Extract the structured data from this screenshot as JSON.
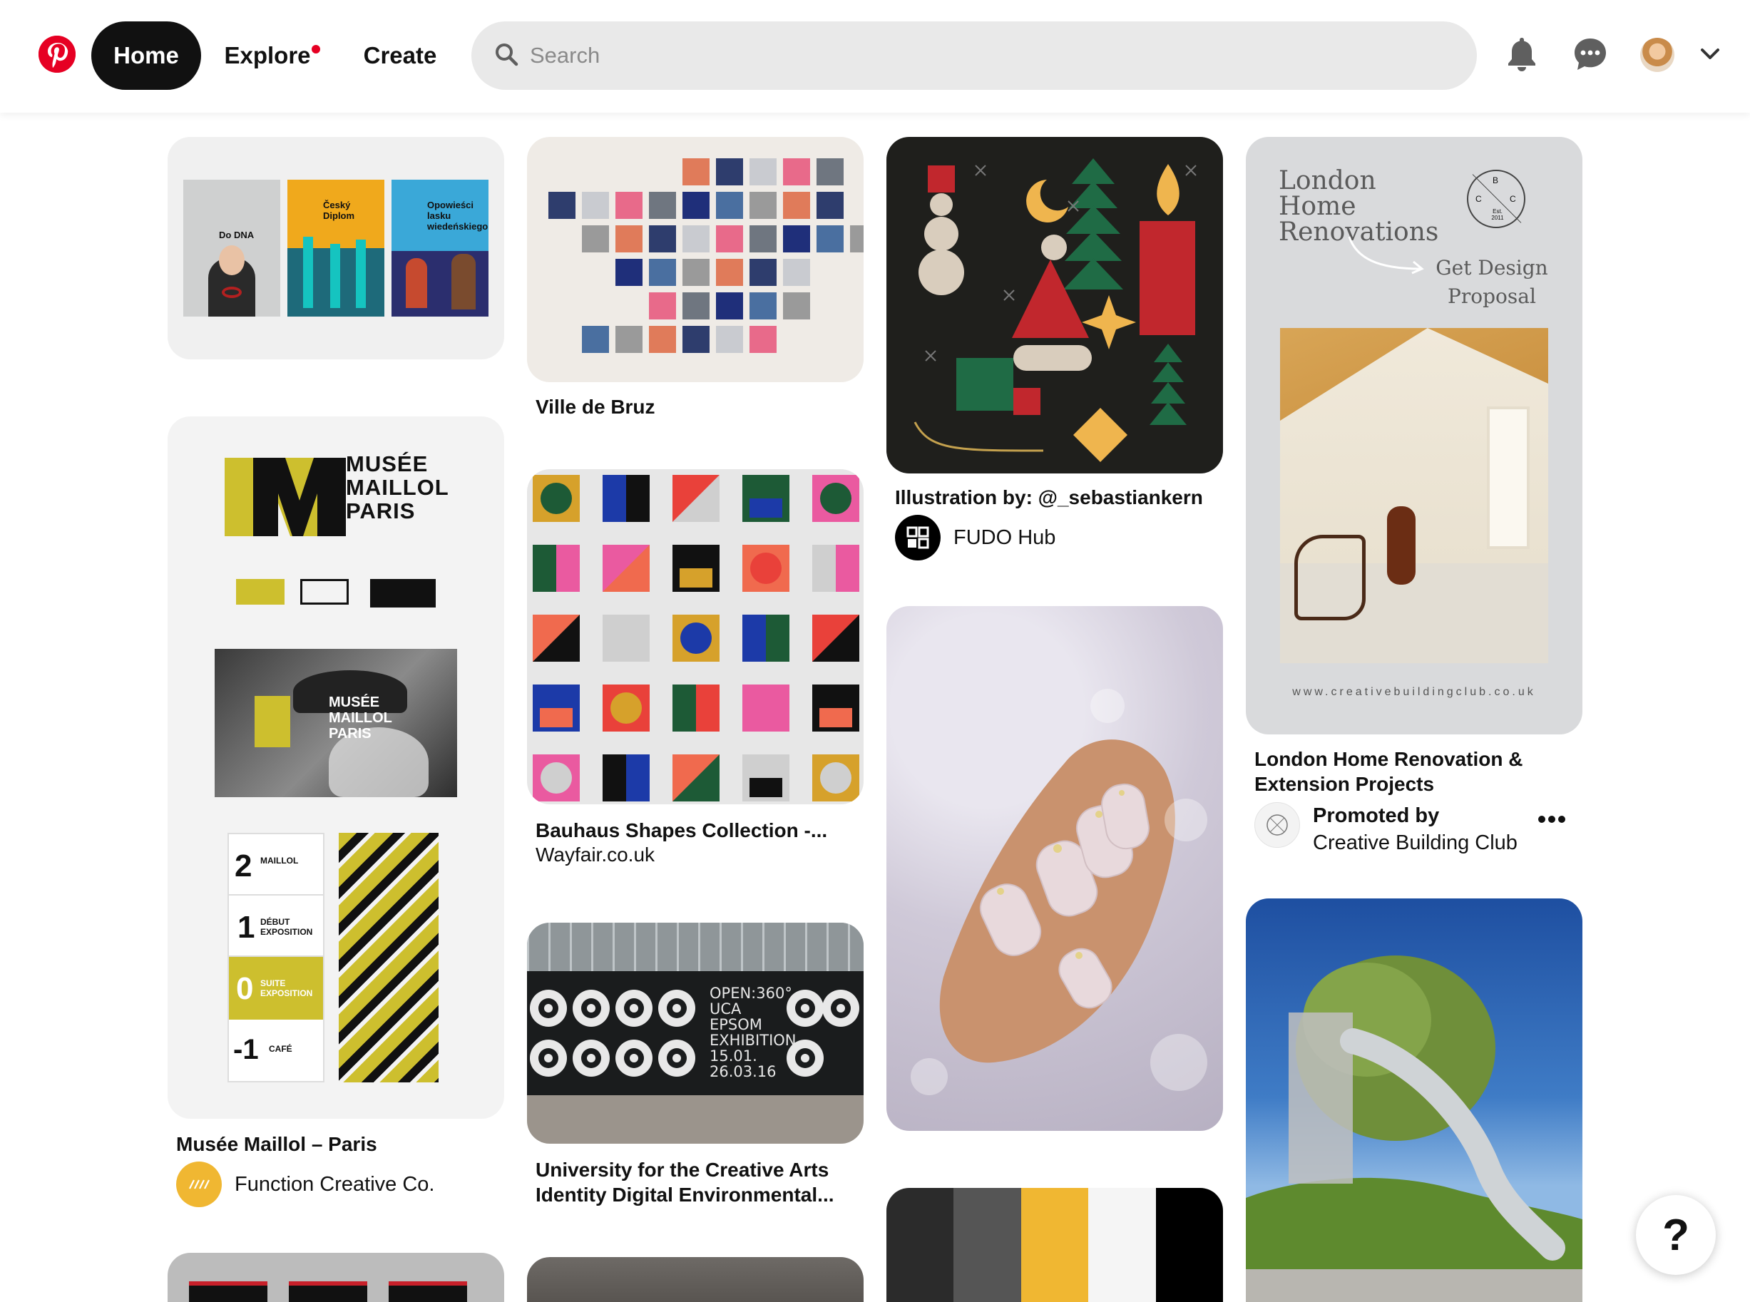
{
  "header": {
    "nav": {
      "home": "Home",
      "explore": "Explore",
      "create": "Create"
    },
    "search_placeholder": "Search"
  },
  "pins": {
    "polish_posters": {
      "poster_titles": [
        "Do DNA",
        "Český Diplom",
        "Opowieści lasku wiedeńskiego"
      ]
    },
    "ville_de_bruz": {
      "title": "Ville de Bruz"
    },
    "illustration": {
      "title": "Illustration by: @_sebastiankern",
      "creator": "FUDO Hub"
    },
    "london_home": {
      "image_heading": "London Home Renovations",
      "image_cta": "Get Design Proposal",
      "image_url": "www.creativebuildingclub.co.uk",
      "badge_letters": [
        "B",
        "C",
        "C"
      ],
      "badge_est": "Est. 2011",
      "title": "London Home Renovation & Extension Projects",
      "promoted_label": "Promoted by",
      "advertiser": "Creative Building Club"
    },
    "musee_maillol": {
      "logo_lines": [
        "MUSÉE",
        "MAILLOL",
        "PARIS"
      ],
      "sign_rows": [
        {
          "num": "2",
          "label": "MAILLOL"
        },
        {
          "num": "1",
          "label": "DÉBUT EXPOSITION"
        },
        {
          "num": "0",
          "label": "SUITE EXPOSITION"
        },
        {
          "num": "-1",
          "label": "CAFÉ"
        }
      ],
      "title": "Musée Maillol – Paris",
      "creator": "Function Creative Co."
    },
    "bauhaus": {
      "title": "Bauhaus Shapes Collection -...",
      "source": "Wayfair.co.uk"
    },
    "uca": {
      "window_text": [
        "OPEN:360°",
        "UCA",
        "EPSOM",
        "EXHIBITION",
        "15.01.",
        "26.03.16"
      ],
      "title": "University for the Creative Arts Identity Digital Environmental..."
    }
  },
  "colors": {
    "brand_red": "#e60023",
    "palette_stripes": [
      "#2b2b2b",
      "#555555",
      "#f0b732",
      "#f5f5f5",
      "#000000"
    ]
  },
  "help_label": "?"
}
